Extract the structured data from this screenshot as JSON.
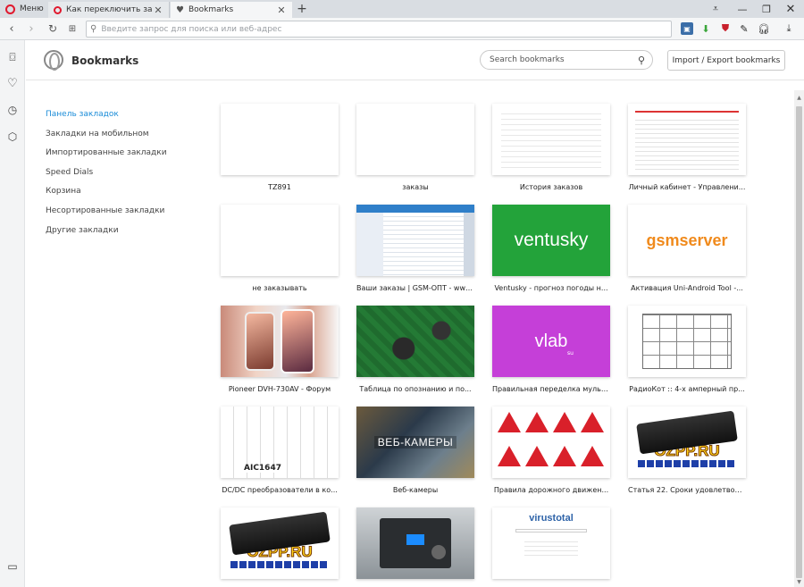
{
  "window": {
    "menu_label": "Меню",
    "tabs": [
      {
        "title": "Как переключить заклад"
      },
      {
        "title": "Bookmarks"
      }
    ]
  },
  "toolbar": {
    "address_placeholder": "Введите запрос для поиска или веб-адрес"
  },
  "header": {
    "title": "Bookmarks",
    "search_placeholder": "Search bookmarks",
    "import_export_label": "Import / Export bookmarks"
  },
  "folders": [
    {
      "label": "Панель закладок",
      "active": true
    },
    {
      "label": "Закладки на мобильном",
      "active": false
    },
    {
      "label": "Импортированные закладки",
      "active": false
    },
    {
      "label": "Speed Dials",
      "active": false
    },
    {
      "label": "Корзина",
      "active": false
    },
    {
      "label": "Несортированные закладки",
      "active": false
    },
    {
      "label": "Другие закладки",
      "active": false
    }
  ],
  "bookmarks": [
    {
      "title": "TZ891",
      "thumb": "blank"
    },
    {
      "title": "заказы",
      "thumb": "blank"
    },
    {
      "title": "История заказов",
      "thumb": "page"
    },
    {
      "title": "Личный кабинет - Управлени...",
      "thumb": "page-red"
    },
    {
      "title": "не заказывать",
      "thumb": "blank"
    },
    {
      "title": "Ваши заказы | GSM-ОПТ - www...",
      "thumb": "page-blue"
    },
    {
      "title": "Ventusky - прогноз погоды н...",
      "thumb": "ventusky",
      "logo_text": "ventusky",
      "accent": "#23a33a"
    },
    {
      "title": "Активация Uni-Android Tool -...",
      "thumb": "gsmserver",
      "logo_text": "gsmserver",
      "accent": "#f08a1c"
    },
    {
      "title": "Pioneer DVH-730AV - Форум",
      "thumb": "phones"
    },
    {
      "title": "Таблица по опознанию и по...",
      "thumb": "pcb"
    },
    {
      "title": "Правильная переделка мульт...",
      "thumb": "vlab",
      "logo_text": "vlab",
      "logo_sub": "su",
      "accent": "#c53fd8"
    },
    {
      "title": "РадиоКот :: 4-х амперный пр...",
      "thumb": "schematic"
    },
    {
      "title": "DC/DC преобразователи в ко...",
      "thumb": "circuit",
      "logo_text": "AIC1647"
    },
    {
      "title": "Веб-камеры",
      "thumb": "webcam",
      "logo_text": "ВЕБ-КАМЕРЫ"
    },
    {
      "title": "Правила дорожного движен...",
      "thumb": "signs"
    },
    {
      "title": "Статья 22. Сроки удовлетвор...",
      "thumb": "ozpp",
      "logo_text": "OZPP.RU"
    },
    {
      "title": "",
      "thumb": "ozpp",
      "logo_text": "OZPP.RU"
    },
    {
      "title": "",
      "thumb": "device"
    },
    {
      "title": "",
      "thumb": "virustotal",
      "logo_text": "virustotal"
    }
  ]
}
